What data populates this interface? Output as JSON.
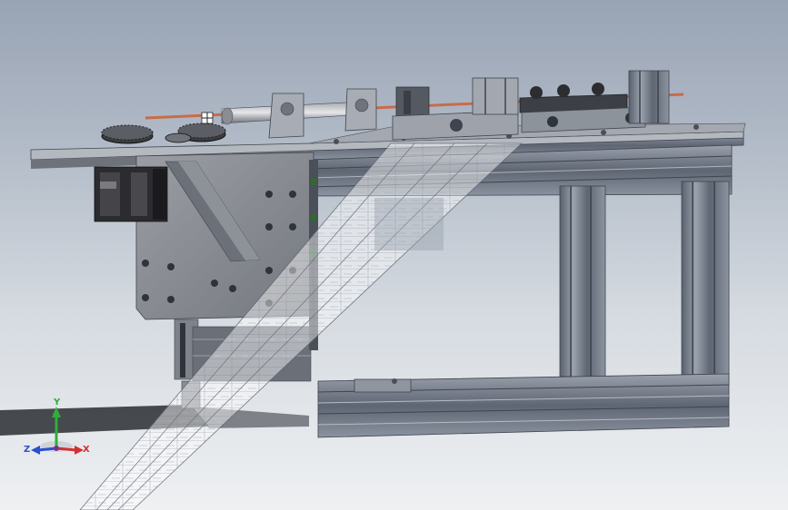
{
  "viewport": {
    "background_top": "#98a3b4",
    "background_bottom": "#eef0f2",
    "model": "cnc-frame-assembly"
  },
  "triad": {
    "x_label": "X",
    "y_label": "Y",
    "z_label": "Z",
    "x_color": "#d23030",
    "y_color": "#2fae3a",
    "z_color": "#2c4fd0"
  },
  "colors": {
    "frame": "#6f7785",
    "frame_dark": "#4f5664",
    "plate": "#8a8e95",
    "motor": "#2b2b2e",
    "rod": "#c96b4a",
    "tape": "#ffffff"
  },
  "icons": [
    "triad-icon",
    "cursor-icon"
  ]
}
